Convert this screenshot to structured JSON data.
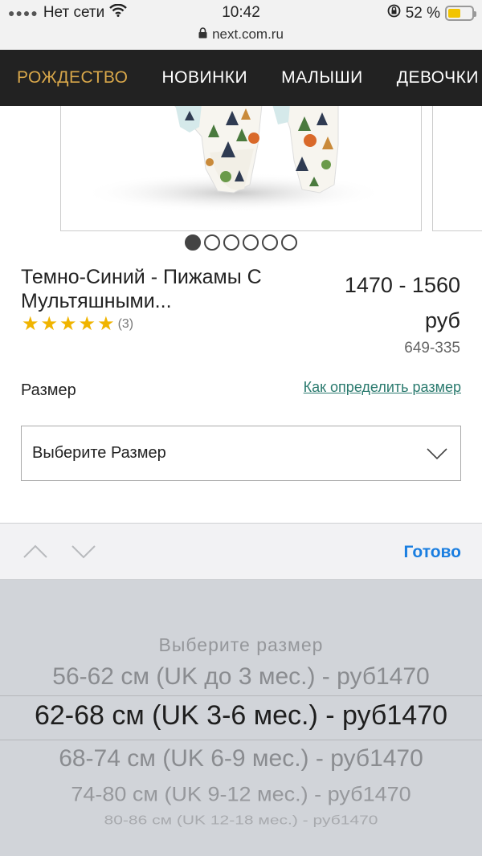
{
  "status_bar": {
    "carrier": "Нет сети",
    "time": "10:42",
    "battery": "52 %",
    "url": "next.com.ru"
  },
  "nav": {
    "items": [
      "РОЖДЕСТВО",
      "НОВИНКИ",
      "МАЛЫШИ",
      "ДЕВОЧКИ"
    ]
  },
  "gallery": {
    "total_images": 6,
    "current_index": 1
  },
  "product": {
    "title_line1": "Темно-Синий - Пижамы С",
    "title_line2": "Мультяшными...",
    "rating_stars": 5,
    "rating_count": "(3)",
    "price_range": "1470 - 1560",
    "currency": "руб",
    "sku": "649-335"
  },
  "size": {
    "label": "Размер",
    "guide_link": "Как определить размер",
    "select_value": "Выберите Размер"
  },
  "picker": {
    "done": "Готово",
    "options": [
      "Выберите размер",
      "56-62 см (UK до 3 мес.) - руб1470",
      "62-68 см (UK 3-6 мес.) - руб1470",
      "68-74 см (UK 6-9 мес.) - руб1470",
      "74-80 см (UK 9-12 мес.) - руб1470",
      "80-86 см (UK 12-18 мес.) - руб1470"
    ],
    "selected_index": 2
  },
  "colors": {
    "nav_bg": "#222222",
    "nav_active": "#d8a74a",
    "link": "#2a7a6e",
    "done": "#1a7ee0",
    "star": "#f0b400"
  }
}
